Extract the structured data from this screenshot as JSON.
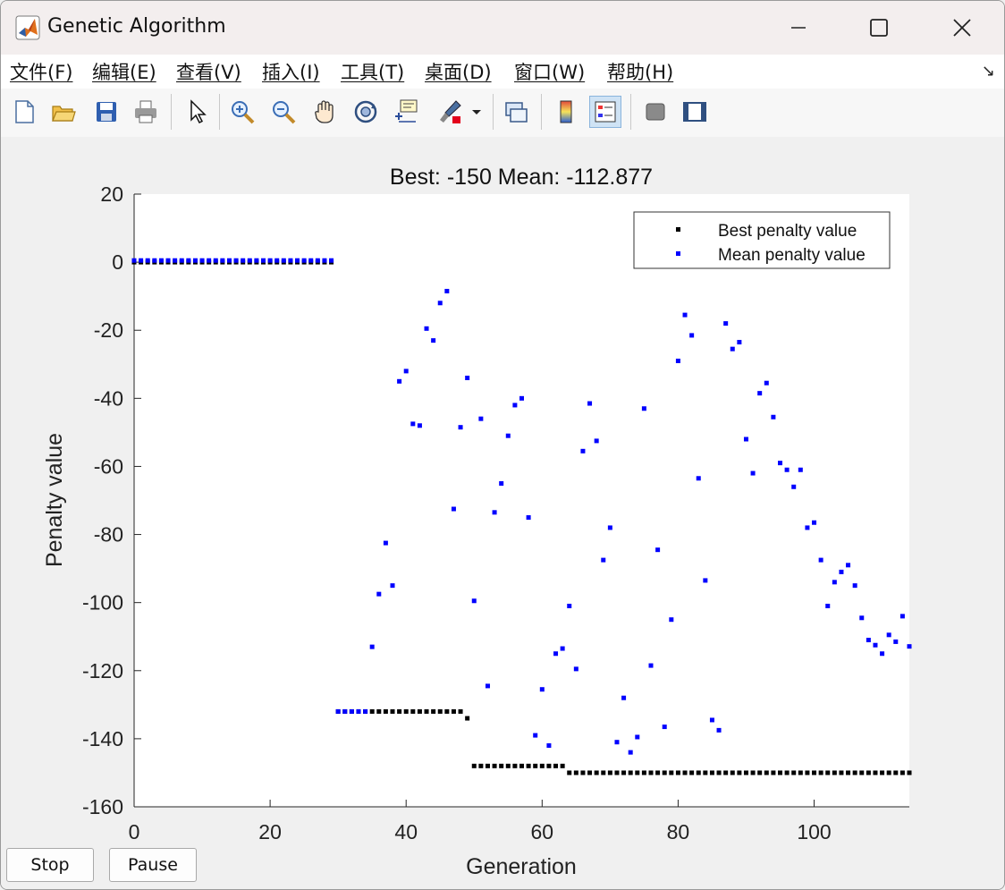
{
  "window": {
    "title": "Genetic Algorithm"
  },
  "menu": [
    "文件(F)",
    "编辑(E)",
    "查看(V)",
    "插入(I)",
    "工具(T)",
    "桌面(D)",
    "窗口(W)",
    "帮助(H)"
  ],
  "controls": {
    "stop_label": "Stop",
    "pause_label": "Pause"
  },
  "toolbar_icons": [
    "new-figure-icon",
    "open-file-icon",
    "save-icon",
    "print-icon",
    "pointer-icon",
    "zoom-in-icon",
    "zoom-out-icon",
    "pan-icon",
    "rotate-3d-icon",
    "data-cursor-icon",
    "brush-icon",
    "link-plot-icon",
    "colorbar-icon",
    "legend-icon",
    "hide-plot-tools-icon",
    "show-plot-tools-icon"
  ],
  "chart_data": {
    "type": "scatter",
    "title": "Best: -150 Mean: -112.877",
    "xlabel": "Generation",
    "ylabel": "Penalty value",
    "xlim": [
      0,
      114
    ],
    "ylim": [
      -160,
      20
    ],
    "xticks": [
      0,
      20,
      40,
      60,
      80,
      100
    ],
    "yticks": [
      20,
      0,
      -20,
      -40,
      -60,
      -80,
      -100,
      -120,
      -140,
      -160
    ],
    "grid": false,
    "legend_position": "top-right",
    "series": [
      {
        "name": "Best penalty value",
        "color": "#000000",
        "points": [
          [
            0,
            0
          ],
          [
            1,
            0
          ],
          [
            2,
            0
          ],
          [
            3,
            0
          ],
          [
            4,
            0
          ],
          [
            5,
            0
          ],
          [
            6,
            0
          ],
          [
            7,
            0
          ],
          [
            8,
            0
          ],
          [
            9,
            0
          ],
          [
            10,
            0
          ],
          [
            11,
            0
          ],
          [
            12,
            0
          ],
          [
            13,
            0
          ],
          [
            14,
            0
          ],
          [
            15,
            0
          ],
          [
            16,
            0
          ],
          [
            17,
            0
          ],
          [
            18,
            0
          ],
          [
            19,
            0
          ],
          [
            20,
            0
          ],
          [
            21,
            0
          ],
          [
            22,
            0
          ],
          [
            23,
            0
          ],
          [
            24,
            0
          ],
          [
            25,
            0
          ],
          [
            26,
            0
          ],
          [
            27,
            0
          ],
          [
            28,
            0
          ],
          [
            29,
            0
          ],
          [
            30,
            -132
          ],
          [
            31,
            -132
          ],
          [
            32,
            -132
          ],
          [
            33,
            -132
          ],
          [
            34,
            -132
          ],
          [
            35,
            -132
          ],
          [
            36,
            -132
          ],
          [
            37,
            -132
          ],
          [
            38,
            -132
          ],
          [
            39,
            -132
          ],
          [
            40,
            -132
          ],
          [
            41,
            -132
          ],
          [
            42,
            -132
          ],
          [
            43,
            -132
          ],
          [
            44,
            -132
          ],
          [
            45,
            -132
          ],
          [
            46,
            -132
          ],
          [
            47,
            -132
          ],
          [
            48,
            -132
          ],
          [
            49,
            -134
          ],
          [
            50,
            -148
          ],
          [
            51,
            -148
          ],
          [
            52,
            -148
          ],
          [
            53,
            -148
          ],
          [
            54,
            -148
          ],
          [
            55,
            -148
          ],
          [
            56,
            -148
          ],
          [
            57,
            -148
          ],
          [
            58,
            -148
          ],
          [
            59,
            -148
          ],
          [
            60,
            -148
          ],
          [
            61,
            -148
          ],
          [
            62,
            -148
          ],
          [
            63,
            -148
          ],
          [
            64,
            -150
          ],
          [
            65,
            -150
          ],
          [
            66,
            -150
          ],
          [
            67,
            -150
          ],
          [
            68,
            -150
          ],
          [
            69,
            -150
          ],
          [
            70,
            -150
          ],
          [
            71,
            -150
          ],
          [
            72,
            -150
          ],
          [
            73,
            -150
          ],
          [
            74,
            -150
          ],
          [
            75,
            -150
          ],
          [
            76,
            -150
          ],
          [
            77,
            -150
          ],
          [
            78,
            -150
          ],
          [
            79,
            -150
          ],
          [
            80,
            -150
          ],
          [
            81,
            -150
          ],
          [
            82,
            -150
          ],
          [
            83,
            -150
          ],
          [
            84,
            -150
          ],
          [
            85,
            -150
          ],
          [
            86,
            -150
          ],
          [
            87,
            -150
          ],
          [
            88,
            -150
          ],
          [
            89,
            -150
          ],
          [
            90,
            -150
          ],
          [
            91,
            -150
          ],
          [
            92,
            -150
          ],
          [
            93,
            -150
          ],
          [
            94,
            -150
          ],
          [
            95,
            -150
          ],
          [
            96,
            -150
          ],
          [
            97,
            -150
          ],
          [
            98,
            -150
          ],
          [
            99,
            -150
          ],
          [
            100,
            -150
          ],
          [
            101,
            -150
          ],
          [
            102,
            -150
          ],
          [
            103,
            -150
          ],
          [
            104,
            -150
          ],
          [
            105,
            -150
          ],
          [
            106,
            -150
          ],
          [
            107,
            -150
          ],
          [
            108,
            -150
          ],
          [
            109,
            -150
          ],
          [
            110,
            -150
          ],
          [
            111,
            -150
          ],
          [
            112,
            -150
          ],
          [
            113,
            -150
          ],
          [
            114,
            -150
          ]
        ]
      },
      {
        "name": "Mean penalty value",
        "color": "#0000ff",
        "points": [
          [
            0,
            0.5
          ],
          [
            1,
            0.5
          ],
          [
            2,
            0.5
          ],
          [
            3,
            0.5
          ],
          [
            4,
            0.5
          ],
          [
            5,
            0.5
          ],
          [
            6,
            0.5
          ],
          [
            7,
            0.5
          ],
          [
            8,
            0.5
          ],
          [
            9,
            0.5
          ],
          [
            10,
            0.5
          ],
          [
            11,
            0.5
          ],
          [
            12,
            0.5
          ],
          [
            13,
            0.5
          ],
          [
            14,
            0.5
          ],
          [
            15,
            0.5
          ],
          [
            16,
            0.5
          ],
          [
            17,
            0.5
          ],
          [
            18,
            0.5
          ],
          [
            19,
            0.5
          ],
          [
            20,
            0.5
          ],
          [
            21,
            0.5
          ],
          [
            22,
            0.5
          ],
          [
            23,
            0.5
          ],
          [
            24,
            0.5
          ],
          [
            25,
            0.5
          ],
          [
            26,
            0.5
          ],
          [
            27,
            0.5
          ],
          [
            28,
            0.5
          ],
          [
            29,
            0.5
          ],
          [
            30,
            -132
          ],
          [
            31,
            -132
          ],
          [
            32,
            -132
          ],
          [
            33,
            -132
          ],
          [
            34,
            -132
          ],
          [
            35,
            -113
          ],
          [
            36,
            -97.5
          ],
          [
            37,
            -82.5
          ],
          [
            38,
            -95
          ],
          [
            39,
            -35
          ],
          [
            40,
            -32
          ],
          [
            41,
            -47.5
          ],
          [
            42,
            -48
          ],
          [
            43,
            -19.5
          ],
          [
            44,
            -23
          ],
          [
            45,
            -12
          ],
          [
            46,
            -8.5
          ],
          [
            47,
            -72.5
          ],
          [
            48,
            -48.5
          ],
          [
            49,
            -34
          ],
          [
            50,
            -99.5
          ],
          [
            51,
            -46
          ],
          [
            52,
            -124.5
          ],
          [
            53,
            -73.5
          ],
          [
            54,
            -65
          ],
          [
            55,
            -51
          ],
          [
            56,
            -42
          ],
          [
            57,
            -40
          ],
          [
            58,
            -75
          ],
          [
            59,
            -139
          ],
          [
            60,
            -125.5
          ],
          [
            61,
            -142
          ],
          [
            62,
            -115
          ],
          [
            63,
            -113.5
          ],
          [
            64,
            -101
          ],
          [
            65,
            -119.5
          ],
          [
            66,
            -55.5
          ],
          [
            67,
            -41.5
          ],
          [
            68,
            -52.5
          ],
          [
            69,
            -87.5
          ],
          [
            70,
            -78
          ],
          [
            71,
            -141
          ],
          [
            72,
            -128
          ],
          [
            73,
            -144
          ],
          [
            74,
            -139.5
          ],
          [
            75,
            -43
          ],
          [
            76,
            -118.5
          ],
          [
            77,
            -84.5
          ],
          [
            78,
            -136.5
          ],
          [
            79,
            -105
          ],
          [
            80,
            -29
          ],
          [
            81,
            -15.5
          ],
          [
            82,
            -21.5
          ],
          [
            83,
            -63.5
          ],
          [
            84,
            -93.5
          ],
          [
            85,
            -134.5
          ],
          [
            86,
            -137.5
          ],
          [
            87,
            -18
          ],
          [
            88,
            -25.5
          ],
          [
            89,
            -23.5
          ],
          [
            90,
            -52
          ],
          [
            91,
            -62
          ],
          [
            92,
            -38.5
          ],
          [
            93,
            -35.5
          ],
          [
            94,
            -45.5
          ],
          [
            95,
            -59
          ],
          [
            96,
            -61
          ],
          [
            97,
            -66
          ],
          [
            98,
            -61
          ],
          [
            99,
            -78
          ],
          [
            100,
            -76.5
          ],
          [
            101,
            -87.5
          ],
          [
            102,
            -101
          ],
          [
            103,
            -94
          ],
          [
            104,
            -91
          ],
          [
            105,
            -89
          ],
          [
            106,
            -95
          ],
          [
            107,
            -104.5
          ],
          [
            108,
            -111
          ],
          [
            109,
            -112.5
          ],
          [
            110,
            -115
          ],
          [
            111,
            -109.5
          ],
          [
            112,
            -111.5
          ],
          [
            113,
            -104
          ],
          [
            114,
            -112.877
          ]
        ]
      }
    ]
  }
}
